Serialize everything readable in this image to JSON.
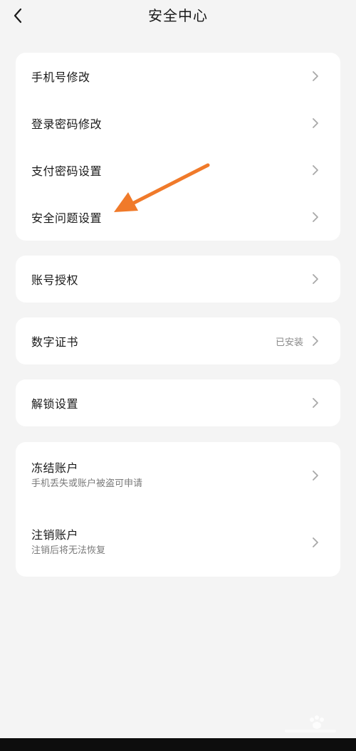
{
  "header": {
    "title": "安全中心",
    "back_icon": "chevron-left-icon"
  },
  "groups": [
    {
      "items": [
        {
          "label": "手机号修改"
        },
        {
          "label": "登录密码修改"
        },
        {
          "label": "支付密码设置"
        },
        {
          "label": "安全问题设置"
        }
      ]
    },
    {
      "items": [
        {
          "label": "账号授权"
        }
      ]
    },
    {
      "items": [
        {
          "label": "数字证书",
          "value": "已安装"
        }
      ]
    },
    {
      "items": [
        {
          "label": "解锁设置"
        }
      ]
    },
    {
      "items": [
        {
          "label": "冻结账户",
          "subtitle": "手机丢失或账户被盗可申请"
        },
        {
          "label": "注销账户",
          "subtitle": "注销后将无法恢复"
        }
      ]
    }
  ],
  "colors": {
    "background": "#f4f4f4",
    "card": "#ffffff",
    "annotation_arrow": "#f07a2a",
    "chevron": "#a8a8a8"
  },
  "icons": {
    "row_chevron": "chevron-right-icon",
    "annotation": "orange-arrow-annotation"
  }
}
